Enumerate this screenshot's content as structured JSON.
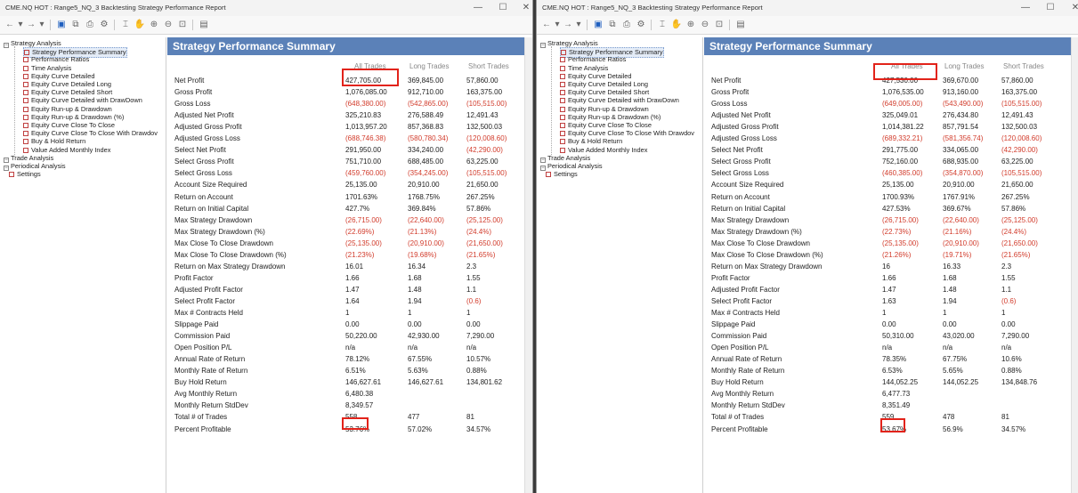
{
  "windows": [
    {
      "title": "CME.NQ HOT : Range5_NQ_3 Backtesting Strategy Performance Report",
      "panel_title": "Strategy Performance Summary",
      "columns": [
        "All Trades",
        "Long Trades",
        "Short Trades"
      ],
      "tree": [
        {
          "label": "Strategy Analysis",
          "level": 0,
          "type": "exp"
        },
        {
          "label": "Strategy Performance Summary",
          "level": 2,
          "type": "ico",
          "selected": true
        },
        {
          "label": "Performance Ratios",
          "level": 2,
          "type": "ico"
        },
        {
          "label": "Time Analysis",
          "level": 2,
          "type": "ico"
        },
        {
          "label": "Equity Curve Detailed",
          "level": 2,
          "type": "ico"
        },
        {
          "label": "Equity Curve Detailed Long",
          "level": 2,
          "type": "ico"
        },
        {
          "label": "Equity Curve Detailed Short",
          "level": 2,
          "type": "ico"
        },
        {
          "label": "Equity Curve Detailed with DrawDown",
          "level": 2,
          "type": "ico"
        },
        {
          "label": "Equity Run-up & Drawdown",
          "level": 2,
          "type": "ico"
        },
        {
          "label": "Equity Run-up & Drawdown (%)",
          "level": 2,
          "type": "ico"
        },
        {
          "label": "Equity Curve Close To Close",
          "level": 2,
          "type": "ico"
        },
        {
          "label": "Equity Curve Close To Close With Drawdov",
          "level": 2,
          "type": "ico"
        },
        {
          "label": "Buy & Hold Return",
          "level": 2,
          "type": "ico"
        },
        {
          "label": "Value Added Monthly Index",
          "level": 2,
          "type": "ico"
        },
        {
          "label": "Trade Analysis",
          "level": 0,
          "type": "exp"
        },
        {
          "label": "Periodical Analysis",
          "level": 0,
          "type": "exp"
        },
        {
          "label": "Settings",
          "level": 1,
          "type": "ico"
        }
      ],
      "rows": [
        {
          "label": "Net Profit",
          "all": "427,705.00",
          "long": "369,845.00",
          "short": "57,860.00"
        },
        {
          "label": "Gross Profit",
          "all": "1,076,085.00",
          "long": "912,710.00",
          "short": "163,375.00"
        },
        {
          "label": "Gross Loss",
          "all": "(648,380.00)",
          "long": "(542,865.00)",
          "short": "(105,515.00)"
        },
        {
          "label": "Adjusted Net Profit",
          "all": "325,210.83",
          "long": "276,588.49",
          "short": "12,491.43"
        },
        {
          "label": "Adjusted Gross Profit",
          "all": "1,013,957.20",
          "long": "857,368.83",
          "short": "132,500.03"
        },
        {
          "label": "Adjusted Gross Loss",
          "all": "(688,746.38)",
          "long": "(580,780.34)",
          "short": "(120,008.60)"
        },
        {
          "label": "Select Net Profit",
          "all": "291,950.00",
          "long": "334,240.00",
          "short": "(42,290.00)"
        },
        {
          "label": "Select Gross Profit",
          "all": "751,710.00",
          "long": "688,485.00",
          "short": "63,225.00"
        },
        {
          "label": "Select Gross Loss",
          "all": "(459,760.00)",
          "long": "(354,245.00)",
          "short": "(105,515.00)"
        },
        {
          "label": "Account Size Required",
          "all": "25,135.00",
          "long": "20,910.00",
          "short": "21,650.00"
        },
        {
          "label": "Return on Account",
          "all": "1701.63%",
          "long": "1768.75%",
          "short": "267.25%"
        },
        {
          "label": "Return on Initial Capital",
          "all": "427.7%",
          "long": "369.84%",
          "short": "57.86%"
        },
        {
          "label": "Max Strategy Drawdown",
          "all": "(26,715.00)",
          "long": "(22,640.00)",
          "short": "(25,125.00)"
        },
        {
          "label": "Max Strategy Drawdown (%)",
          "all": "(22.69%)",
          "long": "(21.13%)",
          "short": "(24.4%)"
        },
        {
          "label": "Max Close To Close Drawdown",
          "all": "(25,135.00)",
          "long": "(20,910.00)",
          "short": "(21,650.00)"
        },
        {
          "label": "Max Close To Close Drawdown (%)",
          "all": "(21.23%)",
          "long": "(19.68%)",
          "short": "(21.65%)"
        },
        {
          "label": "Return on Max Strategy Drawdown",
          "all": "16.01",
          "long": "16.34",
          "short": "2.3"
        },
        {
          "label": "Profit Factor",
          "all": "1.66",
          "long": "1.68",
          "short": "1.55"
        },
        {
          "label": "Adjusted Profit Factor",
          "all": "1.47",
          "long": "1.48",
          "short": "1.1"
        },
        {
          "label": "Select Profit Factor",
          "all": "1.64",
          "long": "1.94",
          "short": "(0.6)"
        },
        {
          "label": "Max # Contracts Held",
          "all": "1",
          "long": "1",
          "short": "1"
        },
        {
          "label": "Slippage Paid",
          "all": "0.00",
          "long": "0.00",
          "short": "0.00"
        },
        {
          "label": "Commission Paid",
          "all": "50,220.00",
          "long": "42,930.00",
          "short": "7,290.00"
        },
        {
          "label": "Open Position P/L",
          "all": "n/a",
          "long": "n/a",
          "short": "n/a"
        },
        {
          "label": "Annual Rate of Return",
          "all": "78.12%",
          "long": "67.55%",
          "short": "10.57%"
        },
        {
          "label": "Monthly Rate of Return",
          "all": "6.51%",
          "long": "5.63%",
          "short": "0.88%"
        },
        {
          "label": "Buy Hold Return",
          "all": "146,627.61",
          "long": "146,627.61",
          "short": "134,801.62"
        },
        {
          "label": "Avg Monthly Return",
          "all": "6,480.38",
          "long": "",
          "short": ""
        },
        {
          "label": "Monthly Return StdDev",
          "all": "8,349.57",
          "long": "",
          "short": ""
        },
        {
          "label": "Total # of Trades",
          "all": "558",
          "long": "477",
          "short": "81"
        },
        {
          "label": "Percent Profitable",
          "all": "53.76%",
          "long": "57.02%",
          "short": "34.57%"
        }
      ]
    },
    {
      "title": "CME.NQ HOT : Range5_NQ_3 Backtesting Strategy Performance Report",
      "panel_title": "Strategy Performance Summary",
      "columns": [
        "All Trades",
        "Long Trades",
        "Short Trades"
      ],
      "tree": [
        {
          "label": "Strategy Analysis",
          "level": 0,
          "type": "exp"
        },
        {
          "label": "Strategy Performance Summary",
          "level": 2,
          "type": "ico",
          "selected": true
        },
        {
          "label": "Performance Ratios",
          "level": 2,
          "type": "ico"
        },
        {
          "label": "Time Analysis",
          "level": 2,
          "type": "ico"
        },
        {
          "label": "Equity Curve Detailed",
          "level": 2,
          "type": "ico"
        },
        {
          "label": "Equity Curve Detailed Long",
          "level": 2,
          "type": "ico"
        },
        {
          "label": "Equity Curve Detailed Short",
          "level": 2,
          "type": "ico"
        },
        {
          "label": "Equity Curve Detailed with DrawDown",
          "level": 2,
          "type": "ico"
        },
        {
          "label": "Equity Run-up & Drawdown",
          "level": 2,
          "type": "ico"
        },
        {
          "label": "Equity Run-up & Drawdown (%)",
          "level": 2,
          "type": "ico"
        },
        {
          "label": "Equity Curve Close To Close",
          "level": 2,
          "type": "ico"
        },
        {
          "label": "Equity Curve Close To Close With Drawdov",
          "level": 2,
          "type": "ico"
        },
        {
          "label": "Buy & Hold Return",
          "level": 2,
          "type": "ico"
        },
        {
          "label": "Value Added Monthly Index",
          "level": 2,
          "type": "ico"
        },
        {
          "label": "Trade Analysis",
          "level": 0,
          "type": "exp"
        },
        {
          "label": "Periodical Analysis",
          "level": 0,
          "type": "exp"
        },
        {
          "label": "Settings",
          "level": 1,
          "type": "ico"
        }
      ],
      "rows": [
        {
          "label": "Net Profit",
          "all": "427,530.00",
          "long": "369,670.00",
          "short": "57,860.00"
        },
        {
          "label": "Gross Profit",
          "all": "1,076,535.00",
          "long": "913,160.00",
          "short": "163,375.00"
        },
        {
          "label": "Gross Loss",
          "all": "(649,005.00)",
          "long": "(543,490.00)",
          "short": "(105,515.00)"
        },
        {
          "label": "Adjusted Net Profit",
          "all": "325,049.01",
          "long": "276,434.80",
          "short": "12,491.43"
        },
        {
          "label": "Adjusted Gross Profit",
          "all": "1,014,381.22",
          "long": "857,791.54",
          "short": "132,500.03"
        },
        {
          "label": "Adjusted Gross Loss",
          "all": "(689,332.21)",
          "long": "(581,356.74)",
          "short": "(120,008.60)"
        },
        {
          "label": "Select Net Profit",
          "all": "291,775.00",
          "long": "334,065.00",
          "short": "(42,290.00)"
        },
        {
          "label": "Select Gross Profit",
          "all": "752,160.00",
          "long": "688,935.00",
          "short": "63,225.00"
        },
        {
          "label": "Select Gross Loss",
          "all": "(460,385.00)",
          "long": "(354,870.00)",
          "short": "(105,515.00)"
        },
        {
          "label": "Account Size Required",
          "all": "25,135.00",
          "long": "20,910.00",
          "short": "21,650.00"
        },
        {
          "label": "Return on Account",
          "all": "1700.93%",
          "long": "1767.91%",
          "short": "267.25%"
        },
        {
          "label": "Return on Initial Capital",
          "all": "427.53%",
          "long": "369.67%",
          "short": "57.86%"
        },
        {
          "label": "Max Strategy Drawdown",
          "all": "(26,715.00)",
          "long": "(22,640.00)",
          "short": "(25,125.00)"
        },
        {
          "label": "Max Strategy Drawdown (%)",
          "all": "(22.73%)",
          "long": "(21.16%)",
          "short": "(24.4%)"
        },
        {
          "label": "Max Close To Close Drawdown",
          "all": "(25,135.00)",
          "long": "(20,910.00)",
          "short": "(21,650.00)"
        },
        {
          "label": "Max Close To Close Drawdown (%)",
          "all": "(21.26%)",
          "long": "(19.71%)",
          "short": "(21.65%)"
        },
        {
          "label": "Return on Max Strategy Drawdown",
          "all": "16",
          "long": "16.33",
          "short": "2.3"
        },
        {
          "label": "Profit Factor",
          "all": "1.66",
          "long": "1.68",
          "short": "1.55"
        },
        {
          "label": "Adjusted Profit Factor",
          "all": "1.47",
          "long": "1.48",
          "short": "1.1"
        },
        {
          "label": "Select Profit Factor",
          "all": "1.63",
          "long": "1.94",
          "short": "(0.6)"
        },
        {
          "label": "Max # Contracts Held",
          "all": "1",
          "long": "1",
          "short": "1"
        },
        {
          "label": "Slippage Paid",
          "all": "0.00",
          "long": "0.00",
          "short": "0.00"
        },
        {
          "label": "Commission Paid",
          "all": "50,310.00",
          "long": "43,020.00",
          "short": "7,290.00"
        },
        {
          "label": "Open Position P/L",
          "all": "n/a",
          "long": "n/a",
          "short": "n/a"
        },
        {
          "label": "Annual Rate of Return",
          "all": "78.35%",
          "long": "67.75%",
          "short": "10.6%"
        },
        {
          "label": "Monthly Rate of Return",
          "all": "6.53%",
          "long": "5.65%",
          "short": "0.88%"
        },
        {
          "label": "Buy  Hold Return",
          "all": "144,052.25",
          "long": "144,052.25",
          "short": "134,848.76"
        },
        {
          "label": "Avg Monthly Return",
          "all": "6,477.73",
          "long": "",
          "short": ""
        },
        {
          "label": "Monthly Return StdDev",
          "all": "8,351.49",
          "long": "",
          "short": ""
        },
        {
          "label": "Total # of Trades",
          "all": "559",
          "long": "478",
          "short": "81"
        },
        {
          "label": "Percent Profitable",
          "all": "53.67%",
          "long": "56.9%",
          "short": "34.57%"
        }
      ]
    }
  ],
  "window_controls": [
    "—",
    "☐",
    "✕"
  ],
  "colors": {
    "header": "#5b81b8",
    "negative": "#d23c2c",
    "highlight": "#e2231a"
  }
}
